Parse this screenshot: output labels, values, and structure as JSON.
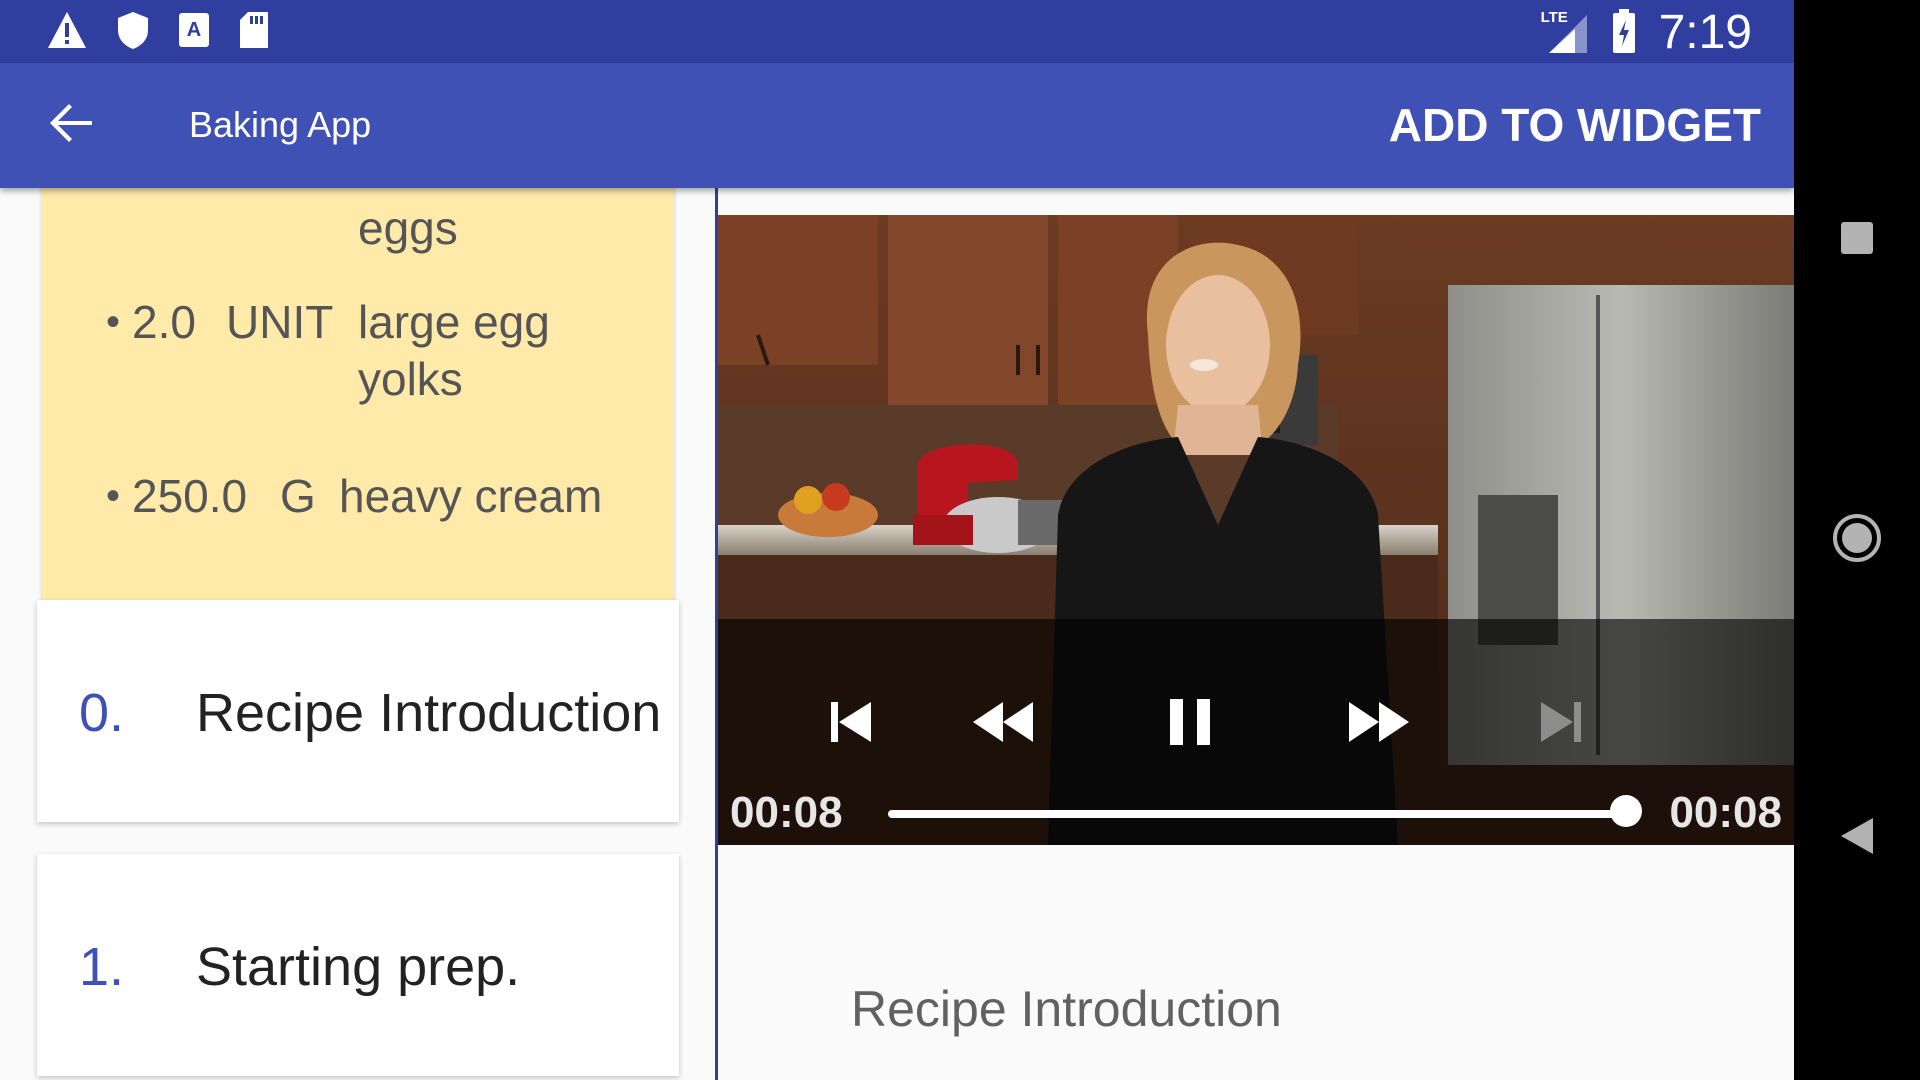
{
  "status_bar": {
    "time": "7:19",
    "network_label": "LTE",
    "icons": [
      "warning-icon",
      "shield-icon",
      "font-icon",
      "sd-card-icon",
      "signal-icon",
      "battery-charging-icon"
    ]
  },
  "app_bar": {
    "title": "Baking App",
    "action": "ADD TO WIDGET",
    "back_icon": "arrow-back-icon"
  },
  "ingredients": [
    {
      "bullet": "",
      "quantity": "",
      "unit": "",
      "name_lines": [
        "eggs"
      ]
    },
    {
      "bullet": "•",
      "quantity": "2.0",
      "unit": "UNIT",
      "name_lines": [
        "large egg",
        "yolks"
      ]
    },
    {
      "bullet": "•",
      "quantity": "250.0",
      "unit": "G",
      "name_lines": [
        "heavy cream"
      ]
    }
  ],
  "steps": [
    {
      "number": "0.",
      "title": "Recipe Introduction"
    },
    {
      "number": "1.",
      "title": "Starting prep."
    }
  ],
  "player": {
    "position": "00:08",
    "duration": "00:08",
    "progress": 1.0,
    "controls": [
      "skip-previous-icon",
      "rewind-icon",
      "pause-icon",
      "fast-forward-icon",
      "skip-next-icon"
    ]
  },
  "step_description": "Recipe Introduction",
  "nav_bar": {
    "icons": [
      "recents-square-icon",
      "home-circle-icon",
      "back-triangle-icon"
    ]
  },
  "colors": {
    "status_bar": "#303f9f",
    "app_bar": "#3f51b5",
    "ingredients_card": "#ffeaaa",
    "step_number": "#3f51b5"
  }
}
